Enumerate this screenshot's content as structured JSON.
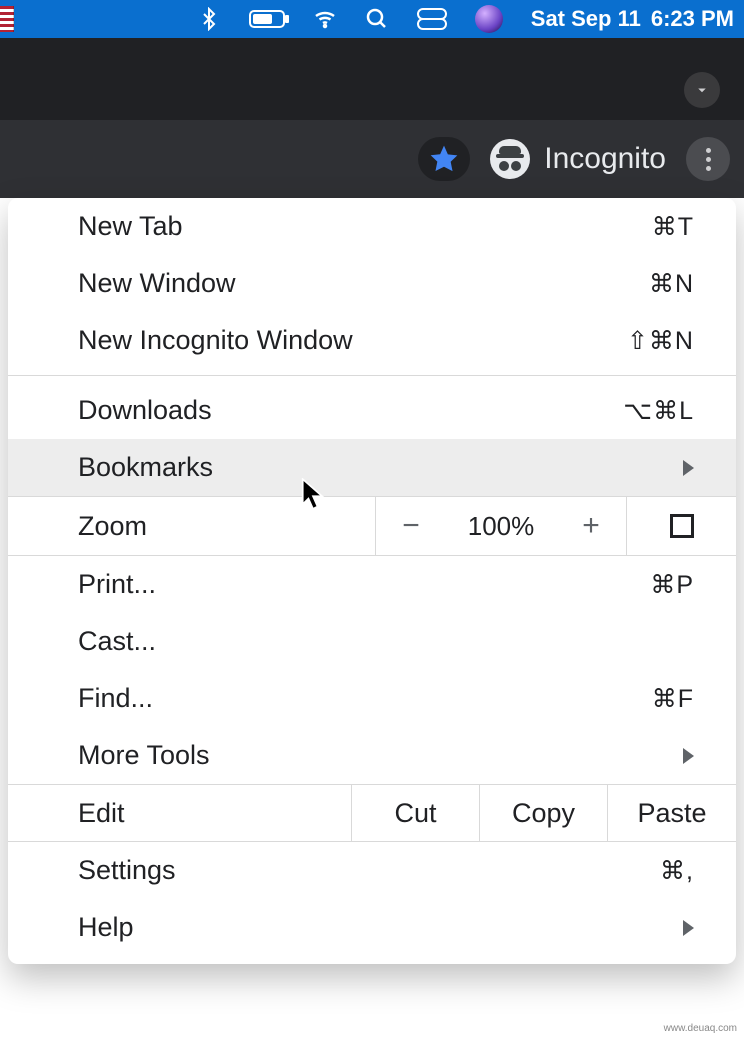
{
  "menubar": {
    "date": "Sat Sep 11",
    "time": "6:23 PM"
  },
  "toolbar": {
    "incognito_label": "Incognito"
  },
  "menu": {
    "new_tab": {
      "label": "New Tab",
      "shortcut": "⌘T"
    },
    "new_window": {
      "label": "New Window",
      "shortcut": "⌘N"
    },
    "new_incognito": {
      "label": "New Incognito Window",
      "shortcut": "⇧⌘N"
    },
    "downloads": {
      "label": "Downloads",
      "shortcut": "⌥⌘L"
    },
    "bookmarks": {
      "label": "Bookmarks"
    },
    "zoom": {
      "label": "Zoom",
      "percent": "100%",
      "minus": "−",
      "plus": "+"
    },
    "print": {
      "label": "Print...",
      "shortcut": "⌘P"
    },
    "cast": {
      "label": "Cast..."
    },
    "find": {
      "label": "Find...",
      "shortcut": "⌘F"
    },
    "more_tools": {
      "label": "More Tools"
    },
    "edit": {
      "label": "Edit",
      "cut": "Cut",
      "copy": "Copy",
      "paste": "Paste"
    },
    "settings": {
      "label": "Settings",
      "shortcut": "⌘,"
    },
    "help": {
      "label": "Help"
    }
  },
  "watermark": "www.deuaq.com"
}
